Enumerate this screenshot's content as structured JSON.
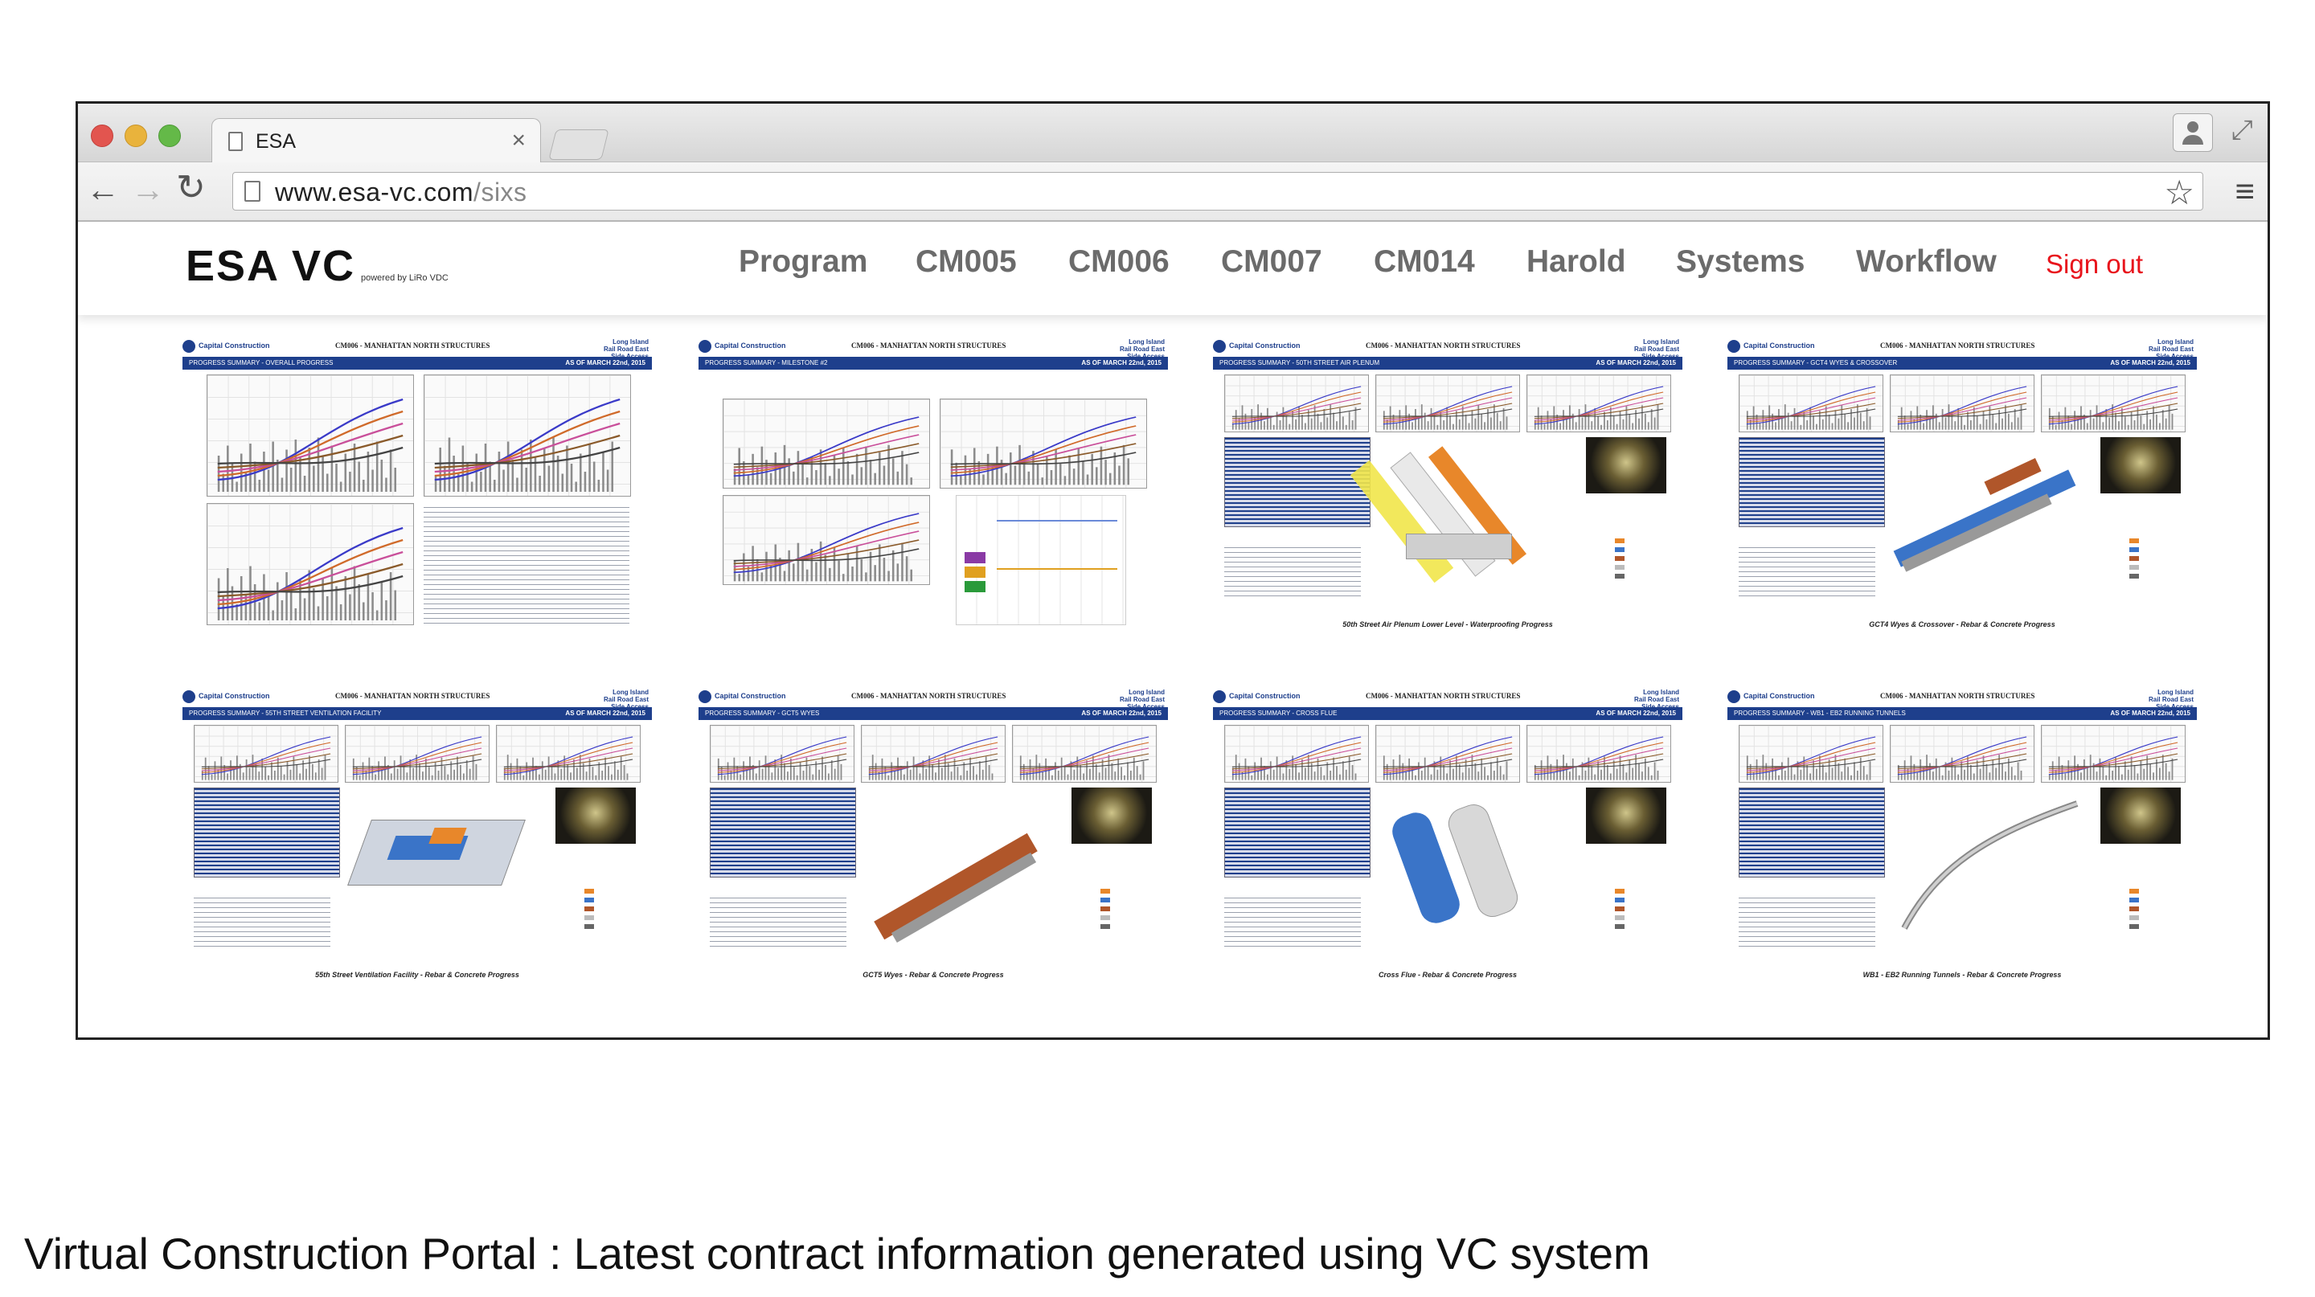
{
  "browser": {
    "tab_title": "ESA",
    "tab_close": "×",
    "url_host": "www.esa-vc.com",
    "url_path": "/sixs",
    "back": "←",
    "forward": "→",
    "reload": "↻",
    "star": "☆",
    "menu": "≡",
    "fullscreen": "⤢"
  },
  "site": {
    "logo": "ESA VC",
    "powered_by": "powered by LiRo VDC",
    "nav": [
      "Program",
      "CM005",
      "CM006",
      "CM007",
      "CM014",
      "Harold",
      "Systems",
      "Workflow"
    ],
    "sign_out": "Sign out",
    "sign_out_color": "#e8141c"
  },
  "thumbnails": [
    {
      "header_left": "Capital Construction",
      "header_title": "CM006 - MANHATTAN NORTH STRUCTURES",
      "header_right": "Long Island Rail Road East Side Access",
      "subtitle": "PROGRESS SUMMARY - OVERALL PROGRESS",
      "date": "AS OF MARCH 22nd, 2015",
      "caption": ""
    },
    {
      "header_left": "Capital Construction",
      "header_title": "CM006 - MANHATTAN NORTH STRUCTURES",
      "header_right": "Long Island Rail Road East Side Access",
      "subtitle": "PROGRESS SUMMARY - MILESTONE #2",
      "date": "AS OF MARCH 22nd, 2015",
      "caption": ""
    },
    {
      "header_left": "Capital Construction",
      "header_title": "CM006 - MANHATTAN NORTH STRUCTURES",
      "header_right": "Long Island Rail Road East Side Access",
      "subtitle": "PROGRESS SUMMARY - 50TH STREET AIR PLENUM",
      "date": "AS OF MARCH 22nd, 2015",
      "caption": "50th Street Air Plenum Lower Level - Waterproofing Progress"
    },
    {
      "header_left": "Capital Construction",
      "header_title": "CM006 - MANHATTAN NORTH STRUCTURES",
      "header_right": "Long Island Rail Road East Side Access",
      "subtitle": "PROGRESS SUMMARY - GCT4 WYES & CROSSOVER",
      "date": "AS OF MARCH 22nd, 2015",
      "caption": "GCT4 Wyes & Crossover - Rebar & Concrete Progress"
    },
    {
      "header_left": "Capital Construction",
      "header_title": "CM006 - MANHATTAN NORTH STRUCTURES",
      "header_right": "Long Island Rail Road East Side Access",
      "subtitle": "PROGRESS SUMMARY - 55TH STREET VENTILATION FACILITY",
      "date": "AS OF MARCH 22nd, 2015",
      "caption": "55th Street Ventilation Facility - Rebar & Concrete Progress"
    },
    {
      "header_left": "Capital Construction",
      "header_title": "CM006 - MANHATTAN NORTH STRUCTURES",
      "header_right": "Long Island Rail Road East Side Access",
      "subtitle": "PROGRESS SUMMARY - GCT5 WYES",
      "date": "AS OF MARCH 22nd, 2015",
      "caption": "GCT5 Wyes - Rebar & Concrete Progress"
    },
    {
      "header_left": "Capital Construction",
      "header_title": "CM006 - MANHATTAN NORTH STRUCTURES",
      "header_right": "Long Island Rail Road East Side Access",
      "subtitle": "PROGRESS SUMMARY - CROSS FLUE",
      "date": "AS OF MARCH 22nd, 2015",
      "caption": "Cross Flue - Rebar & Concrete Progress"
    },
    {
      "header_left": "Capital Construction",
      "header_title": "CM006 - MANHATTAN NORTH STRUCTURES",
      "header_right": "Long Island Rail Road East Side Access",
      "subtitle": "PROGRESS SUMMARY - WB1 - EB2 RUNNING TUNNELS",
      "date": "AS OF MARCH 22nd, 2015",
      "caption": "WB1 - EB2 Running Tunnels - Rebar & Concrete Progress"
    }
  ],
  "slide_caption": "Virtual Construction Portal : Latest contract information generated using VC system"
}
